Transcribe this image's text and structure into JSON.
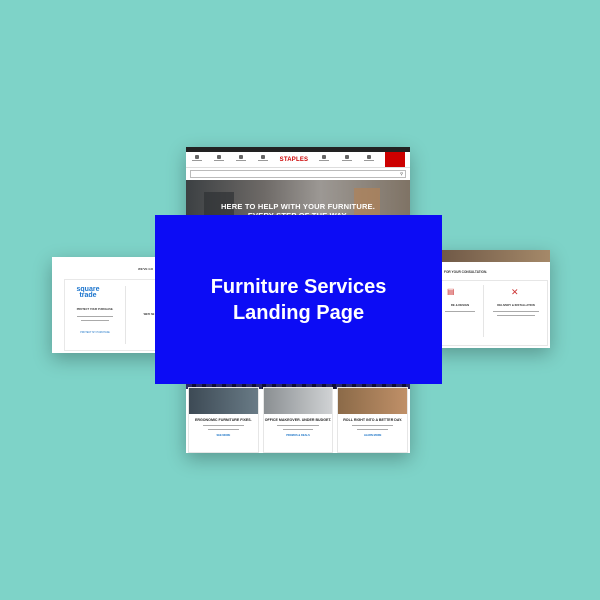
{
  "overlay": {
    "title_line1": "Furniture Services",
    "title_line2": "Landing Page"
  },
  "mockup": {
    "brand": "STAPLES",
    "hero_line1": "HERE TO HELP WITH YOUR FURNITURE.",
    "hero_line2": "EVERY STEP OF THE WAY.",
    "cards": [
      {
        "title": "ERGONOMIC FURNITURE FIXES.",
        "link": "SEE MORE"
      },
      {
        "title": "OFFICE MAKEOVER. UNDER BUDGET.",
        "link": "PROMOS & DEALS"
      },
      {
        "title": "ROLL RIGHT INTO A BETTER DAY.",
        "link": "LEARN MORE"
      }
    ]
  },
  "left_panel": {
    "heading": "WE'VE GO",
    "logo_line1": "square",
    "logo_line2": "trade",
    "card_title": "PROTECT YOUR PURCHASE.",
    "link": "PROTECT MY PURCHASE",
    "card2_title": "WE'D SE"
  },
  "right_panel": {
    "heading": "FOR YOUR CONSULTATION.",
    "item1": "RE & DESIGN",
    "item2": "DELIVERY & INSTALLATION"
  },
  "colors": {
    "background": "#7ed3c8",
    "overlay": "#0c0cf5",
    "brand": "#cc0000"
  }
}
